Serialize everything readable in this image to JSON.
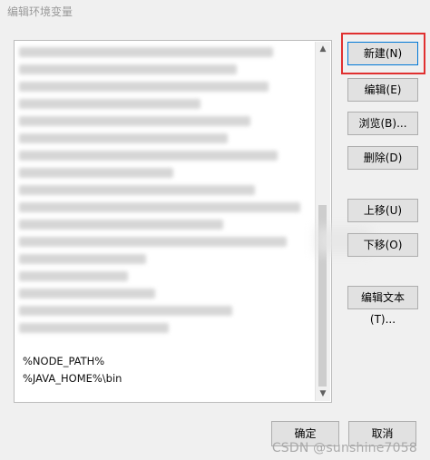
{
  "window": {
    "title": "编辑环境变量"
  },
  "list": {
    "visible_entries": [
      {
        "text": "%NODE_PATH%"
      },
      {
        "text": "%JAVA_HOME%\\bin"
      }
    ],
    "redacted_count": 17
  },
  "buttons": {
    "new": "新建(N)",
    "edit": "编辑(E)",
    "browse": "浏览(B)...",
    "delete": "删除(D)",
    "move_up": "上移(U)",
    "move_down": "下移(O)",
    "edit_text": "编辑文本(T)...",
    "ok": "确定",
    "cancel": "取消"
  },
  "watermark": "CSDN @sunshine7058",
  "colors": {
    "window_bg": "#f0f0f0",
    "button_bg": "#e1e1e1",
    "focus_border": "#0078d7",
    "highlight_box": "#e03030"
  }
}
